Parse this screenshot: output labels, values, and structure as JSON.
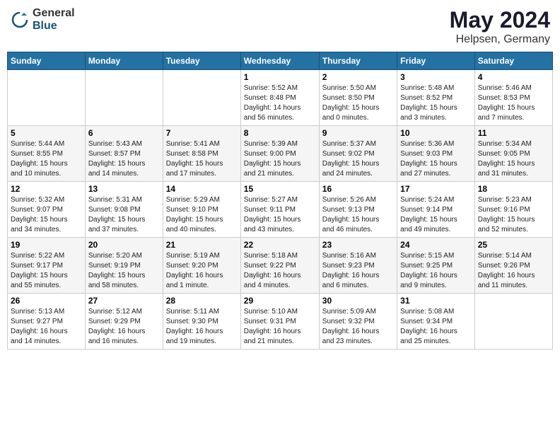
{
  "header": {
    "logo_general": "General",
    "logo_blue": "Blue",
    "month_year": "May 2024",
    "location": "Helpsen, Germany"
  },
  "columns": [
    "Sunday",
    "Monday",
    "Tuesday",
    "Wednesday",
    "Thursday",
    "Friday",
    "Saturday"
  ],
  "weeks": [
    {
      "days": [
        {
          "num": "",
          "info": ""
        },
        {
          "num": "",
          "info": ""
        },
        {
          "num": "",
          "info": ""
        },
        {
          "num": "1",
          "info": "Sunrise: 5:52 AM\nSunset: 8:48 PM\nDaylight: 14 hours\nand 56 minutes."
        },
        {
          "num": "2",
          "info": "Sunrise: 5:50 AM\nSunset: 8:50 PM\nDaylight: 15 hours\nand 0 minutes."
        },
        {
          "num": "3",
          "info": "Sunrise: 5:48 AM\nSunset: 8:52 PM\nDaylight: 15 hours\nand 3 minutes."
        },
        {
          "num": "4",
          "info": "Sunrise: 5:46 AM\nSunset: 8:53 PM\nDaylight: 15 hours\nand 7 minutes."
        }
      ]
    },
    {
      "days": [
        {
          "num": "5",
          "info": "Sunrise: 5:44 AM\nSunset: 8:55 PM\nDaylight: 15 hours\nand 10 minutes."
        },
        {
          "num": "6",
          "info": "Sunrise: 5:43 AM\nSunset: 8:57 PM\nDaylight: 15 hours\nand 14 minutes."
        },
        {
          "num": "7",
          "info": "Sunrise: 5:41 AM\nSunset: 8:58 PM\nDaylight: 15 hours\nand 17 minutes."
        },
        {
          "num": "8",
          "info": "Sunrise: 5:39 AM\nSunset: 9:00 PM\nDaylight: 15 hours\nand 21 minutes."
        },
        {
          "num": "9",
          "info": "Sunrise: 5:37 AM\nSunset: 9:02 PM\nDaylight: 15 hours\nand 24 minutes."
        },
        {
          "num": "10",
          "info": "Sunrise: 5:36 AM\nSunset: 9:03 PM\nDaylight: 15 hours\nand 27 minutes."
        },
        {
          "num": "11",
          "info": "Sunrise: 5:34 AM\nSunset: 9:05 PM\nDaylight: 15 hours\nand 31 minutes."
        }
      ]
    },
    {
      "days": [
        {
          "num": "12",
          "info": "Sunrise: 5:32 AM\nSunset: 9:07 PM\nDaylight: 15 hours\nand 34 minutes."
        },
        {
          "num": "13",
          "info": "Sunrise: 5:31 AM\nSunset: 9:08 PM\nDaylight: 15 hours\nand 37 minutes."
        },
        {
          "num": "14",
          "info": "Sunrise: 5:29 AM\nSunset: 9:10 PM\nDaylight: 15 hours\nand 40 minutes."
        },
        {
          "num": "15",
          "info": "Sunrise: 5:27 AM\nSunset: 9:11 PM\nDaylight: 15 hours\nand 43 minutes."
        },
        {
          "num": "16",
          "info": "Sunrise: 5:26 AM\nSunset: 9:13 PM\nDaylight: 15 hours\nand 46 minutes."
        },
        {
          "num": "17",
          "info": "Sunrise: 5:24 AM\nSunset: 9:14 PM\nDaylight: 15 hours\nand 49 minutes."
        },
        {
          "num": "18",
          "info": "Sunrise: 5:23 AM\nSunset: 9:16 PM\nDaylight: 15 hours\nand 52 minutes."
        }
      ]
    },
    {
      "days": [
        {
          "num": "19",
          "info": "Sunrise: 5:22 AM\nSunset: 9:17 PM\nDaylight: 15 hours\nand 55 minutes."
        },
        {
          "num": "20",
          "info": "Sunrise: 5:20 AM\nSunset: 9:19 PM\nDaylight: 15 hours\nand 58 minutes."
        },
        {
          "num": "21",
          "info": "Sunrise: 5:19 AM\nSunset: 9:20 PM\nDaylight: 16 hours\nand 1 minute."
        },
        {
          "num": "22",
          "info": "Sunrise: 5:18 AM\nSunset: 9:22 PM\nDaylight: 16 hours\nand 4 minutes."
        },
        {
          "num": "23",
          "info": "Sunrise: 5:16 AM\nSunset: 9:23 PM\nDaylight: 16 hours\nand 6 minutes."
        },
        {
          "num": "24",
          "info": "Sunrise: 5:15 AM\nSunset: 9:25 PM\nDaylight: 16 hours\nand 9 minutes."
        },
        {
          "num": "25",
          "info": "Sunrise: 5:14 AM\nSunset: 9:26 PM\nDaylight: 16 hours\nand 11 minutes."
        }
      ]
    },
    {
      "days": [
        {
          "num": "26",
          "info": "Sunrise: 5:13 AM\nSunset: 9:27 PM\nDaylight: 16 hours\nand 14 minutes."
        },
        {
          "num": "27",
          "info": "Sunrise: 5:12 AM\nSunset: 9:29 PM\nDaylight: 16 hours\nand 16 minutes."
        },
        {
          "num": "28",
          "info": "Sunrise: 5:11 AM\nSunset: 9:30 PM\nDaylight: 16 hours\nand 19 minutes."
        },
        {
          "num": "29",
          "info": "Sunrise: 5:10 AM\nSunset: 9:31 PM\nDaylight: 16 hours\nand 21 minutes."
        },
        {
          "num": "30",
          "info": "Sunrise: 5:09 AM\nSunset: 9:32 PM\nDaylight: 16 hours\nand 23 minutes."
        },
        {
          "num": "31",
          "info": "Sunrise: 5:08 AM\nSunset: 9:34 PM\nDaylight: 16 hours\nand 25 minutes."
        },
        {
          "num": "",
          "info": ""
        }
      ]
    }
  ]
}
